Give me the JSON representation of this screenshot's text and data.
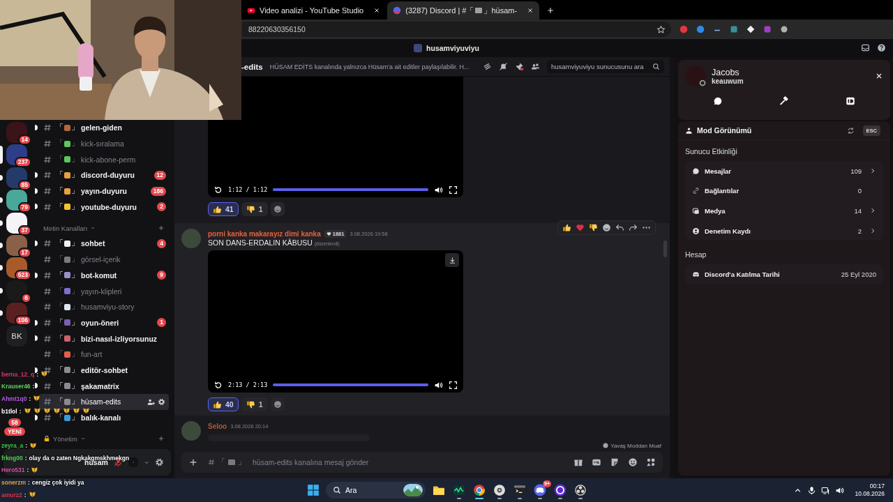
{
  "browser": {
    "tabs": [
      {
        "kind": "youtube",
        "title": "Video analizi - YouTube Studio",
        "selected": false
      },
      {
        "kind": "discord",
        "title": "(3287) Discord | #「",
        "title_tail": "」hüsam-",
        "selected": true
      }
    ],
    "address": "88220630356150"
  },
  "discord": {
    "server_name": "husamviyuviyu",
    "servers": [
      {
        "badge": "14",
        "selected": false,
        "unread": false
      },
      {
        "badge": "237",
        "selected": true,
        "unread": false
      },
      {
        "badge": "85",
        "selected": false,
        "unread": true
      },
      {
        "badge": "79",
        "selected": false,
        "unread": true
      },
      {
        "badge": "37",
        "selected": false,
        "unread": true
      },
      {
        "badge": "17",
        "selected": false,
        "unread": true
      },
      {
        "badge": "523",
        "selected": false,
        "unread": true
      },
      {
        "badge": "6",
        "selected": false,
        "unread": true
      },
      {
        "badge": "106",
        "selected": false,
        "unread": true
      },
      {
        "label": "BK",
        "selected": false,
        "unread": false
      }
    ],
    "new_pill": {
      "count": "58",
      "label": "YENİ"
    },
    "channels": [
      {
        "kind": "channel",
        "open": "「",
        "close": "」",
        "name": "gelen-giden",
        "color": "#b5653a",
        "unread": true,
        "selected": false
      },
      {
        "kind": "channel",
        "open": "「",
        "close": "」",
        "name": "kick-sıralama",
        "color": "#5cc85c",
        "unread": false,
        "selected": false
      },
      {
        "kind": "channel",
        "open": "「",
        "close": "」",
        "name": "kick-abone-perm",
        "color": "#5cc85c",
        "unread": false,
        "selected": false
      },
      {
        "kind": "channel",
        "open": "「",
        "close": "」",
        "name": "discord-duyuru",
        "color": "#e8a040",
        "unread": true,
        "selected": false,
        "badge": "12"
      },
      {
        "kind": "channel",
        "open": "「",
        "close": "」",
        "name": "yayın-duyuru",
        "color": "#e8a040",
        "unread": true,
        "selected": false,
        "badge": "186"
      },
      {
        "kind": "channel",
        "open": "「",
        "close": "」",
        "name": "youtube-duyuru",
        "color": "#f4c430",
        "unread": true,
        "selected": false,
        "badge": "2"
      },
      {
        "kind": "category",
        "name": "Metin Kanalları",
        "locked": false
      },
      {
        "kind": "channel",
        "open": "「",
        "close": "」",
        "name": "sohbet",
        "color": "#f0f0f0",
        "unread": true,
        "selected": false,
        "badge": "4"
      },
      {
        "kind": "channel",
        "open": "「",
        "close": "」",
        "name": "görsel-içerik",
        "color": "#7a7a80",
        "unread": false,
        "selected": false
      },
      {
        "kind": "channel",
        "open": "「",
        "close": "」",
        "name": "bot-komut",
        "color": "#9b8fc8",
        "unread": true,
        "selected": false,
        "badge": "9"
      },
      {
        "kind": "channel",
        "open": "「",
        "close": "」",
        "name": "yayın-klipleri",
        "color": "#7b6fd0",
        "unread": false,
        "selected": false
      },
      {
        "kind": "channel",
        "open": "「",
        "close": "」",
        "name": "husamviyu-story",
        "color": "#dfe6ee",
        "unread": false,
        "selected": false
      },
      {
        "kind": "channel",
        "open": "「",
        "close": "」",
        "name": "oyun-öneri",
        "color": "#7a5fb0",
        "unread": true,
        "selected": false,
        "badge": "1"
      },
      {
        "kind": "channel",
        "open": "「",
        "close": "」",
        "name": "bizi-nasıl-izliyorsunuz",
        "color": "#d0606a",
        "unread": true,
        "selected": false
      },
      {
        "kind": "channel",
        "open": "「",
        "close": "」",
        "name": "fun-art",
        "color": "#e0604a",
        "unread": false,
        "selected": false
      },
      {
        "kind": "channel",
        "open": "「",
        "close": "」",
        "name": "editör-sohbet",
        "color": "#8a8a90",
        "unread": true,
        "selected": false
      },
      {
        "kind": "channel",
        "open": "「",
        "close": "」",
        "name": "şakamatrix",
        "color": "#8a8a90",
        "unread": true,
        "selected": false
      },
      {
        "kind": "channel",
        "open": "「",
        "close": "」",
        "name": "hüsam-edits",
        "color": "#8a8a90",
        "unread": false,
        "selected": true
      },
      {
        "kind": "channel",
        "open": "「",
        "close": "」",
        "name": "balık-kanalı",
        "color": "#3a9ad9",
        "unread": true,
        "selected": false
      },
      {
        "kind": "category",
        "name": "Yönetim",
        "locked": true
      }
    ],
    "user_panel": {
      "name": "hüsam"
    },
    "header": {
      "channel": "-edits",
      "topic": "HÜSAM EDİTS kanalında yalnızca Hüsam'a ait editler paylaşılabilir. H...",
      "search_placeholder": "husamviyuviyu sunucusunu ara"
    },
    "messages": [
      {
        "kind": "video-only",
        "video": {
          "time": "1:12 / 1:12",
          "level": 1
        },
        "reactions": [
          {
            "kind": "thumbs-up",
            "count": "41",
            "selected": true
          },
          {
            "kind": "thumbs-down",
            "count": "1",
            "selected": false
          }
        ]
      },
      {
        "kind": "post",
        "author": "porni kanka makarayız dimi kanka",
        "color": "#e8603c",
        "tag": "1881",
        "time": "3.08.2026 19:58",
        "text": "SON DANS-ERDALIN KÂBUSU",
        "edited": "(düzenlendi)",
        "hovered": true,
        "video": {
          "time": "2:13 / 2:13",
          "level": 1,
          "download": true
        },
        "reactions": [
          {
            "kind": "thumbs-up",
            "count": "40",
            "selected": true
          },
          {
            "kind": "thumbs-down",
            "count": "1",
            "selected": false
          }
        ]
      },
      {
        "kind": "post",
        "author": "Seloo",
        "color": "#b0583c",
        "time": "3.08.2026 20:14",
        "hovered": false,
        "loading": true
      }
    ],
    "slowmode": "Yavaş Moddan Muaf",
    "composer": {
      "open": "「",
      "close": "」",
      "placeholder": "hüsam-edits kanalına mesaj gönder"
    }
  },
  "profile": {
    "display_name": "Jacobs",
    "username": "keauwum",
    "tabs": [
      {
        "kind": "messages"
      },
      {
        "kind": "moderation"
      },
      {
        "kind": "id"
      }
    ],
    "mod_view": "Mod Görünümü",
    "esc": "ESC",
    "activity_title": "Sunucu Etkinliği",
    "activity": [
      {
        "kind": "messages",
        "label": "Mesajlar",
        "value": "109",
        "more": true
      },
      {
        "kind": "links",
        "label": "Bağlantılar",
        "value": "0",
        "more": false
      },
      {
        "kind": "media",
        "label": "Medya",
        "value": "14",
        "more": true
      },
      {
        "kind": "audit",
        "label": "Denetim Kaydı",
        "value": "2",
        "more": true
      }
    ],
    "account_title": "Hesap",
    "account": [
      {
        "kind": "discord",
        "label": "Discord'a Katılma Tarihi",
        "value": "25 Eyl 2020"
      }
    ]
  },
  "stream_chat": [
    {
      "user": "berna_12_q",
      "sep": ":",
      "color": "#e0306a",
      "emotes": [
        {
          "kind": "moth"
        }
      ]
    },
    {
      "user": "Krauser46",
      "sep": ":",
      "color": "#5ad15a"
    },
    {
      "user": "Ahmt1q0",
      "sep": ":",
      "color": "#b05ae0",
      "emotes": [
        {
          "kind": "moth"
        }
      ]
    },
    {
      "user": "b1tlol",
      "sep": ":",
      "color": "#ffffff",
      "emotes": [
        {
          "kind": "moth"
        },
        {
          "kind": "moth"
        },
        {
          "kind": "moth"
        },
        {
          "kind": "moth"
        },
        {
          "kind": "moth"
        },
        {
          "kind": "moth"
        },
        {
          "kind": "moth"
        }
      ]
    },
    {
      "user": "zeyra_a",
      "sep": ":",
      "color": "#3cc24a",
      "emotes": [
        {
          "kind": "moth"
        }
      ]
    },
    {
      "user": "frkng00",
      "sep": ":",
      "color": "#4bd04b",
      "text": "olay da o zaten Ngkakgmskhmekgn"
    },
    {
      "user": "Hero531",
      "sep": ":",
      "color": "#d04ba0",
      "emotes": [
        {
          "kind": "moth"
        }
      ]
    },
    {
      "user": "sonerzm",
      "sep": ":",
      "color": "#d9a23c",
      "text": "cengiz çok iyidi ya"
    },
    {
      "user": "amurz2",
      "sep": ":",
      "color": "#e0304a",
      "emotes": [
        {
          "kind": "moth"
        }
      ]
    }
  ],
  "taskbar": {
    "search": "Ara",
    "apps": [
      {
        "kind": "explorer",
        "selected": false,
        "running": false
      },
      {
        "kind": "monitor",
        "selected": false,
        "running": true
      },
      {
        "kind": "chrome",
        "selected": true,
        "running": true
      },
      {
        "kind": "disc",
        "selected": false,
        "running": true
      },
      {
        "kind": "terminal",
        "selected": false,
        "running": true
      },
      {
        "kind": "discord",
        "selected": false,
        "running": true,
        "badge": "9+"
      },
      {
        "kind": "ring",
        "selected": false,
        "running": true
      },
      {
        "kind": "obs",
        "selected": false,
        "running": true
      }
    ],
    "time": "00:17",
    "date": "10.08.2026"
  }
}
